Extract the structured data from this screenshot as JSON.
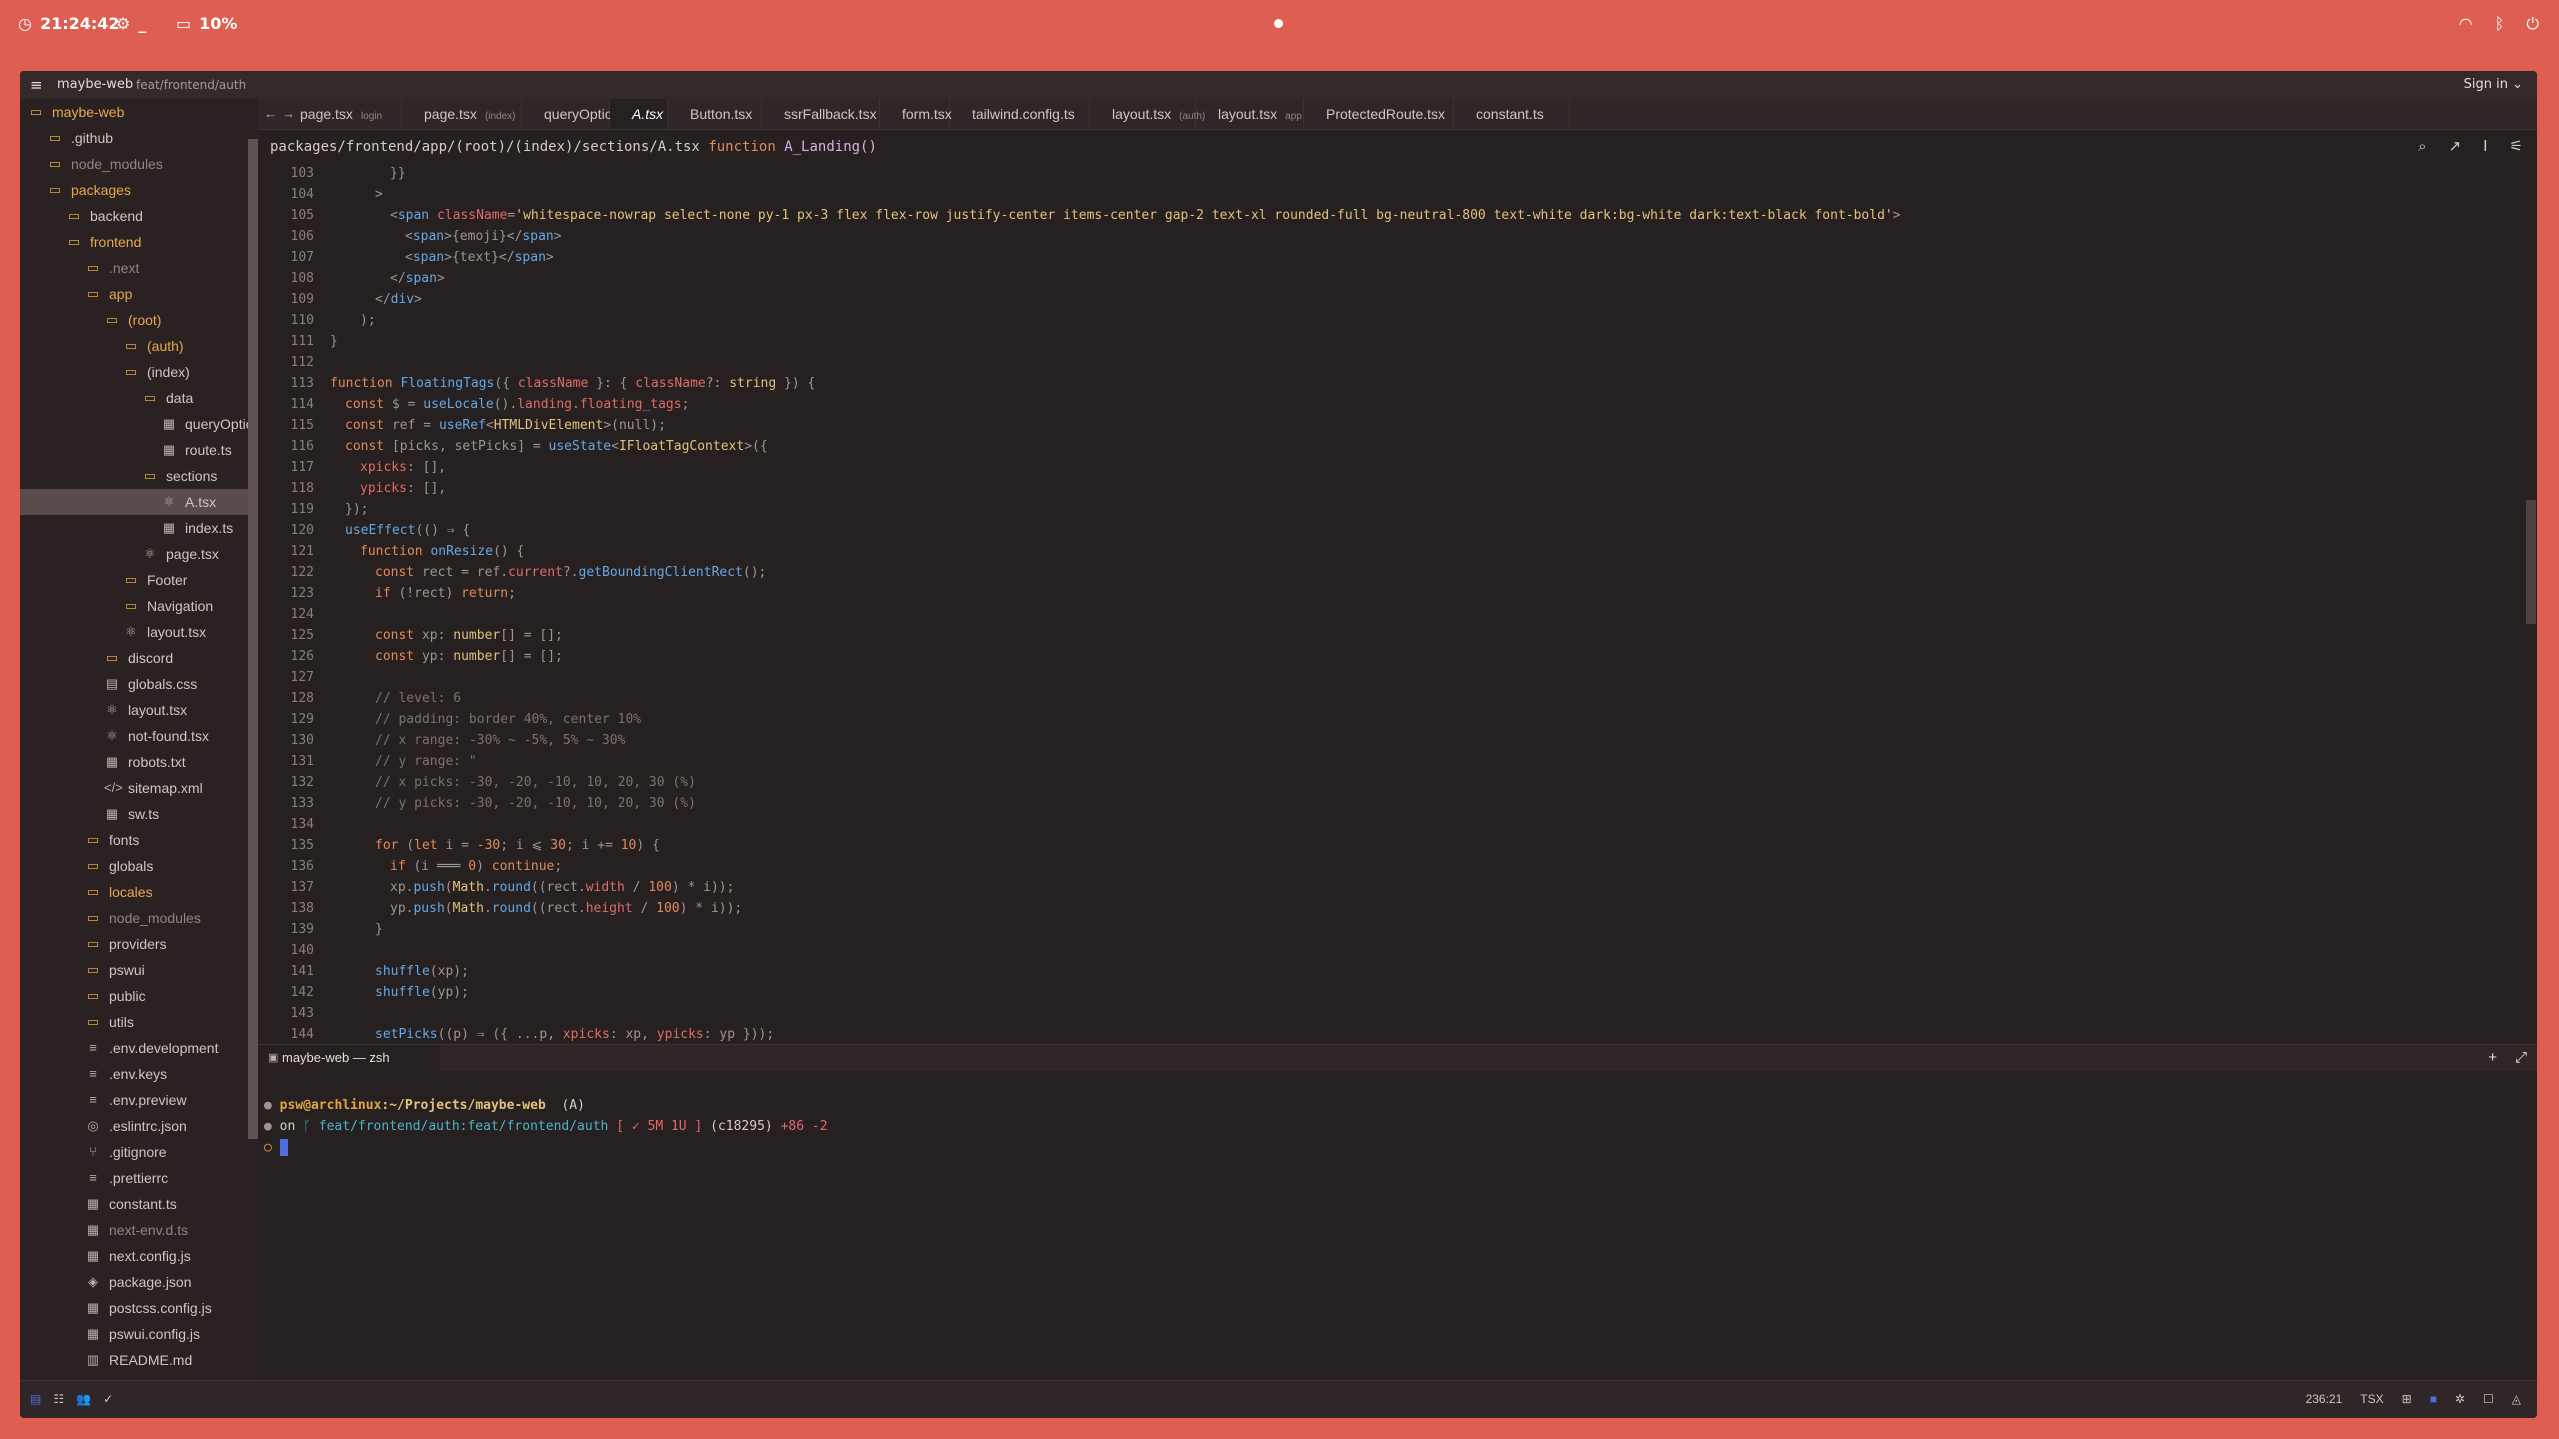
{
  "system": {
    "time": "21:24:42",
    "battery": "10%",
    "tray": [
      "wifi-icon",
      "bluetooth-icon",
      "power-icon"
    ]
  },
  "window": {
    "project": "maybe-web",
    "branch": "feat/frontend/auth",
    "sign_in": "Sign in"
  },
  "sidebar": {
    "items": [
      {
        "label": "maybe-web",
        "depth": 0,
        "icon": "folder-open",
        "color": "orange"
      },
      {
        "label": ".github",
        "depth": 1,
        "icon": "folder"
      },
      {
        "label": "node_modules",
        "depth": 1,
        "icon": "folder",
        "color": "dim"
      },
      {
        "label": "packages",
        "depth": 1,
        "icon": "folder-open",
        "color": "orange"
      },
      {
        "label": "backend",
        "depth": 2,
        "icon": "folder"
      },
      {
        "label": "frontend",
        "depth": 2,
        "icon": "folder-open",
        "color": "orange"
      },
      {
        "label": ".next",
        "depth": 3,
        "icon": "folder",
        "color": "dim"
      },
      {
        "label": "app",
        "depth": 3,
        "icon": "folder-open",
        "color": "orange"
      },
      {
        "label": "(root)",
        "depth": 4,
        "icon": "folder-open",
        "color": "orange"
      },
      {
        "label": "(auth)",
        "depth": 5,
        "icon": "folder",
        "color": "orange"
      },
      {
        "label": "(index)",
        "depth": 5,
        "icon": "folder-open"
      },
      {
        "label": "data",
        "depth": 6,
        "icon": "folder-open"
      },
      {
        "label": "queryOption.ts",
        "depth": 7,
        "icon": "file"
      },
      {
        "label": "route.ts",
        "depth": 7,
        "icon": "file"
      },
      {
        "label": "sections",
        "depth": 6,
        "icon": "folder-open"
      },
      {
        "label": "A.tsx",
        "depth": 7,
        "icon": "react",
        "selected": true
      },
      {
        "label": "index.ts",
        "depth": 7,
        "icon": "file"
      },
      {
        "label": "page.tsx",
        "depth": 6,
        "icon": "react"
      },
      {
        "label": "Footer",
        "depth": 5,
        "icon": "folder"
      },
      {
        "label": "Navigation",
        "depth": 5,
        "icon": "folder"
      },
      {
        "label": "layout.tsx",
        "depth": 5,
        "icon": "react"
      },
      {
        "label": "discord",
        "depth": 4,
        "icon": "folder"
      },
      {
        "label": "globals.css",
        "depth": 4,
        "icon": "css"
      },
      {
        "label": "layout.tsx",
        "depth": 4,
        "icon": "react"
      },
      {
        "label": "not-found.tsx",
        "depth": 4,
        "icon": "react"
      },
      {
        "label": "robots.txt",
        "depth": 4,
        "icon": "file"
      },
      {
        "label": "sitemap.xml",
        "depth": 4,
        "icon": "code"
      },
      {
        "label": "sw.ts",
        "depth": 4,
        "icon": "file"
      },
      {
        "label": "fonts",
        "depth": 3,
        "icon": "folder"
      },
      {
        "label": "globals",
        "depth": 3,
        "icon": "folder"
      },
      {
        "label": "locales",
        "depth": 3,
        "icon": "folder",
        "color": "orange"
      },
      {
        "label": "node_modules",
        "depth": 3,
        "icon": "folder",
        "color": "dim"
      },
      {
        "label": "providers",
        "depth": 3,
        "icon": "folder"
      },
      {
        "label": "pswui",
        "depth": 3,
        "icon": "folder"
      },
      {
        "label": "public",
        "depth": 3,
        "icon": "folder"
      },
      {
        "label": "utils",
        "depth": 3,
        "icon": "folder"
      },
      {
        "label": ".env.development",
        "depth": 3,
        "icon": "list"
      },
      {
        "label": ".env.keys",
        "depth": 3,
        "icon": "list"
      },
      {
        "label": ".env.preview",
        "depth": 3,
        "icon": "list"
      },
      {
        "label": ".eslintrc.json",
        "depth": 3,
        "icon": "settings"
      },
      {
        "label": ".gitignore",
        "depth": 3,
        "icon": "git"
      },
      {
        "label": ".prettierrc",
        "depth": 3,
        "icon": "list"
      },
      {
        "label": "constant.ts",
        "depth": 3,
        "icon": "file"
      },
      {
        "label": "next-env.d.ts",
        "depth": 3,
        "icon": "file",
        "color": "dim"
      },
      {
        "label": "next.config.js",
        "depth": 3,
        "icon": "file"
      },
      {
        "label": "package.json",
        "depth": 3,
        "icon": "package"
      },
      {
        "label": "postcss.config.js",
        "depth": 3,
        "icon": "file"
      },
      {
        "label": "pswui.config.js",
        "depth": 3,
        "icon": "file"
      },
      {
        "label": "README.md",
        "depth": 3,
        "icon": "book"
      }
    ]
  },
  "editor": {
    "tabs": [
      {
        "label": "page.tsx",
        "hint": "login"
      },
      {
        "label": "page.tsx",
        "hint": "(index)"
      },
      {
        "label": "queryOption.ts",
        "hint": ""
      },
      {
        "label": "A.tsx",
        "hint": "",
        "active": true
      },
      {
        "label": "Button.tsx",
        "hint": ""
      },
      {
        "label": "ssrFallback.tsx",
        "hint": ""
      },
      {
        "label": "form.tsx",
        "hint": ""
      },
      {
        "label": "tailwind.config.ts",
        "hint": ""
      },
      {
        "label": "layout.tsx",
        "hint": "(auth)"
      },
      {
        "label": "layout.tsx",
        "hint": "app"
      },
      {
        "label": "ProtectedRoute.tsx",
        "hint": ""
      },
      {
        "label": "constant.ts",
        "hint": ""
      }
    ],
    "breadcrumb_path": "packages/frontend/app/(root)/(index)/sections/A.tsx",
    "breadcrumb_kw": "function",
    "breadcrumb_fn": "A_Landing()",
    "lines": [
      {
        "n": "103",
        "i": 4,
        "tokens": [
          [
            "g",
            "}}"
          ]
        ]
      },
      {
        "n": "104",
        "i": 3,
        "tokens": [
          [
            "g",
            ">"
          ]
        ]
      },
      {
        "n": "105",
        "i": 4,
        "tokens": [
          [
            "g",
            "<"
          ],
          [
            "f",
            "span"
          ],
          [
            "g",
            " "
          ],
          [
            "p",
            "className"
          ],
          [
            "g",
            "="
          ],
          [
            "s",
            "'whitespace-nowrap select-none py-1 px-3 flex flex-row justify-center items-center gap-2 text-xl rounded-full bg-neutral-800 text-white dark:bg-white dark:text-black font-bold'"
          ],
          [
            "g",
            ">"
          ]
        ]
      },
      {
        "n": "106",
        "i": 5,
        "tokens": [
          [
            "g",
            "<"
          ],
          [
            "f",
            "span"
          ],
          [
            "g",
            ">{emoji}</"
          ],
          [
            "f",
            "span"
          ],
          [
            "g",
            ">"
          ]
        ]
      },
      {
        "n": "107",
        "i": 5,
        "tokens": [
          [
            "g",
            "<"
          ],
          [
            "f",
            "span"
          ],
          [
            "g",
            ">{text}</"
          ],
          [
            "f",
            "span"
          ],
          [
            "g",
            ">"
          ]
        ]
      },
      {
        "n": "108",
        "i": 4,
        "tokens": [
          [
            "g",
            "</"
          ],
          [
            "f",
            "span"
          ],
          [
            "g",
            ">"
          ]
        ]
      },
      {
        "n": "109",
        "i": 3,
        "tokens": [
          [
            "g",
            "</"
          ],
          [
            "f",
            "div"
          ],
          [
            "g",
            ">"
          ]
        ]
      },
      {
        "n": "110",
        "i": 2,
        "tokens": [
          [
            "g",
            ");"
          ]
        ]
      },
      {
        "n": "111",
        "i": 0,
        "tokens": [
          [
            "g",
            "}"
          ]
        ]
      },
      {
        "n": "112",
        "i": 0,
        "tokens": []
      },
      {
        "n": "113",
        "i": 0,
        "tokens": [
          [
            "k",
            "function "
          ],
          [
            "f",
            "FloatingTags"
          ],
          [
            "g",
            "({ "
          ],
          [
            "p",
            "className"
          ],
          [
            "g",
            " }: { "
          ],
          [
            "p",
            "className"
          ],
          [
            "g",
            "?: "
          ],
          [
            "t",
            "string"
          ],
          [
            "g",
            " }) {"
          ]
        ]
      },
      {
        "n": "114",
        "i": 1,
        "tokens": [
          [
            "k",
            "const "
          ],
          [
            "g",
            "$ = "
          ],
          [
            "f",
            "useLocale"
          ],
          [
            "g",
            "()."
          ],
          [
            "p",
            "landing"
          ],
          [
            "g",
            "."
          ],
          [
            "p",
            "floating_tags"
          ],
          [
            "g",
            ";"
          ]
        ]
      },
      {
        "n": "115",
        "i": 1,
        "tokens": [
          [
            "k",
            "const "
          ],
          [
            "g",
            "ref = "
          ],
          [
            "f",
            "useRef"
          ],
          [
            "g",
            "<"
          ],
          [
            "t",
            "HTMLDivElement"
          ],
          [
            "g",
            ">(null);"
          ]
        ]
      },
      {
        "n": "116",
        "i": 1,
        "tokens": [
          [
            "k",
            "const "
          ],
          [
            "g",
            "[picks, setPicks] = "
          ],
          [
            "f",
            "useState"
          ],
          [
            "g",
            "<"
          ],
          [
            "t",
            "IFloatTagContext"
          ],
          [
            "g",
            ">({"
          ]
        ]
      },
      {
        "n": "117",
        "i": 2,
        "tokens": [
          [
            "p",
            "xpicks"
          ],
          [
            "g",
            ": [],"
          ]
        ]
      },
      {
        "n": "118",
        "i": 2,
        "tokens": [
          [
            "p",
            "ypicks"
          ],
          [
            "g",
            ": [],"
          ]
        ]
      },
      {
        "n": "119",
        "i": 1,
        "tokens": [
          [
            "g",
            "});"
          ]
        ]
      },
      {
        "n": "120",
        "i": 1,
        "tokens": [
          [
            "f",
            "useEffect"
          ],
          [
            "g",
            "(() ⇒ {"
          ]
        ]
      },
      {
        "n": "121",
        "i": 2,
        "tokens": [
          [
            "k",
            "function "
          ],
          [
            "f",
            "onResize"
          ],
          [
            "g",
            "() {"
          ]
        ]
      },
      {
        "n": "122",
        "i": 3,
        "tokens": [
          [
            "k",
            "const "
          ],
          [
            "g",
            "rect = ref."
          ],
          [
            "p",
            "current"
          ],
          [
            "g",
            "?."
          ],
          [
            "f",
            "getBoundingClientRect"
          ],
          [
            "g",
            "();"
          ]
        ]
      },
      {
        "n": "123",
        "i": 3,
        "tokens": [
          [
            "k",
            "if "
          ],
          [
            "g",
            "(!rect) "
          ],
          [
            "k",
            "return"
          ],
          [
            "g",
            ";"
          ]
        ]
      },
      {
        "n": "124",
        "i": 0,
        "tokens": []
      },
      {
        "n": "125",
        "i": 3,
        "tokens": [
          [
            "k",
            "const "
          ],
          [
            "g",
            "xp: "
          ],
          [
            "t",
            "number"
          ],
          [
            "g",
            "[] = [];"
          ]
        ]
      },
      {
        "n": "126",
        "i": 3,
        "tokens": [
          [
            "k",
            "const "
          ],
          [
            "g",
            "yp: "
          ],
          [
            "t",
            "number"
          ],
          [
            "g",
            "[] = [];"
          ]
        ]
      },
      {
        "n": "127",
        "i": 0,
        "tokens": []
      },
      {
        "n": "128",
        "i": 3,
        "tokens": [
          [
            "c",
            "// level: 6"
          ]
        ]
      },
      {
        "n": "129",
        "i": 3,
        "tokens": [
          [
            "c",
            "// padding: border 40%, center 10%"
          ]
        ]
      },
      {
        "n": "130",
        "i": 3,
        "tokens": [
          [
            "c",
            "// x range: -30% ~ -5%, 5% ~ 30%"
          ]
        ]
      },
      {
        "n": "131",
        "i": 3,
        "tokens": [
          [
            "c",
            "// y range: \""
          ]
        ]
      },
      {
        "n": "132",
        "i": 3,
        "tokens": [
          [
            "c",
            "// x picks: -30, -20, -10, 10, 20, 30 (%)"
          ]
        ]
      },
      {
        "n": "133",
        "i": 3,
        "tokens": [
          [
            "c",
            "// y picks: -30, -20, -10, 10, 20, 30 (%)"
          ]
        ]
      },
      {
        "n": "134",
        "i": 0,
        "tokens": []
      },
      {
        "n": "135",
        "i": 3,
        "tokens": [
          [
            "k",
            "for "
          ],
          [
            "g",
            "("
          ],
          [
            "k",
            "let "
          ],
          [
            "g",
            "i = "
          ],
          [
            "n",
            "-30"
          ],
          [
            "g",
            "; i ⩽ "
          ],
          [
            "n",
            "30"
          ],
          [
            "g",
            "; i += "
          ],
          [
            "n",
            "10"
          ],
          [
            "g",
            ") {"
          ]
        ]
      },
      {
        "n": "136",
        "i": 4,
        "tokens": [
          [
            "k",
            "if "
          ],
          [
            "g",
            "(i ═══ "
          ],
          [
            "n",
            "0"
          ],
          [
            "g",
            ") "
          ],
          [
            "k",
            "continue"
          ],
          [
            "g",
            ";"
          ]
        ]
      },
      {
        "n": "137",
        "i": 4,
        "tokens": [
          [
            "g",
            "xp."
          ],
          [
            "f",
            "push"
          ],
          [
            "g",
            "("
          ],
          [
            "t",
            "Math"
          ],
          [
            "g",
            "."
          ],
          [
            "f",
            "round"
          ],
          [
            "g",
            "((rect."
          ],
          [
            "p",
            "width"
          ],
          [
            "g",
            " / "
          ],
          [
            "n",
            "100"
          ],
          [
            "g",
            ") * i));"
          ]
        ]
      },
      {
        "n": "138",
        "i": 4,
        "tokens": [
          [
            "g",
            "yp."
          ],
          [
            "f",
            "push"
          ],
          [
            "g",
            "("
          ],
          [
            "t",
            "Math"
          ],
          [
            "g",
            "."
          ],
          [
            "f",
            "round"
          ],
          [
            "g",
            "((rect."
          ],
          [
            "p",
            "height"
          ],
          [
            "g",
            " / "
          ],
          [
            "n",
            "100"
          ],
          [
            "g",
            ") * i));"
          ]
        ]
      },
      {
        "n": "139",
        "i": 3,
        "tokens": [
          [
            "g",
            "}"
          ]
        ]
      },
      {
        "n": "140",
        "i": 0,
        "tokens": []
      },
      {
        "n": "141",
        "i": 3,
        "tokens": [
          [
            "f",
            "shuffle"
          ],
          [
            "g",
            "(xp);"
          ]
        ]
      },
      {
        "n": "142",
        "i": 3,
        "tokens": [
          [
            "f",
            "shuffle"
          ],
          [
            "g",
            "(yp);"
          ]
        ]
      },
      {
        "n": "143",
        "i": 0,
        "tokens": []
      },
      {
        "n": "144",
        "i": 3,
        "tokens": [
          [
            "f",
            "setPicks"
          ],
          [
            "g",
            "((p) ⇒ ({ ...p, "
          ],
          [
            "p",
            "xpicks"
          ],
          [
            "g",
            ": xp, "
          ],
          [
            "p",
            "ypicks"
          ],
          [
            "g",
            ": yp }));"
          ]
        ]
      }
    ]
  },
  "terminal": {
    "tab_label": "maybe-web — zsh",
    "prompt_user": "psw@archlinux",
    "prompt_path": ":~/Projects/maybe-web",
    "prompt_extra": "(A)",
    "git_on": "on",
    "git_branch": "ᚴ feat/frontend/auth:feat/frontend/auth",
    "git_status": "[ ✓ 5M 1U ]",
    "git_hash": "(c18295)",
    "git_diff": "+86 -2"
  },
  "status": {
    "position": "236:21",
    "language": "TSX"
  }
}
